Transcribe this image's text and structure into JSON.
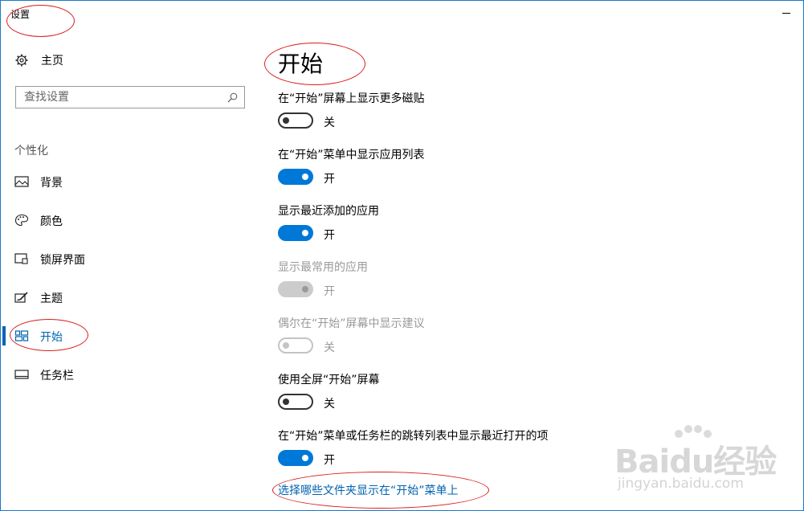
{
  "window": {
    "title": "设置"
  },
  "sidebar": {
    "home_label": "主页",
    "search_placeholder": "查找设置",
    "section_label": "个性化",
    "items": [
      {
        "label": "背景",
        "icon": "picture-icon",
        "active": false
      },
      {
        "label": "颜色",
        "icon": "palette-icon",
        "active": false
      },
      {
        "label": "锁屏界面",
        "icon": "lock-screen-icon",
        "active": false
      },
      {
        "label": "主题",
        "icon": "theme-icon",
        "active": false
      },
      {
        "label": "开始",
        "icon": "start-tiles-icon",
        "active": true
      },
      {
        "label": "任务栏",
        "icon": "taskbar-icon",
        "active": false
      }
    ]
  },
  "main": {
    "title": "开始",
    "settings": [
      {
        "label": "在“开始”屏幕上显示更多磁贴",
        "state": "关",
        "on": false,
        "enabled": true
      },
      {
        "label": "在“开始”菜单中显示应用列表",
        "state": "开",
        "on": true,
        "enabled": true
      },
      {
        "label": "显示最近添加的应用",
        "state": "开",
        "on": true,
        "enabled": true
      },
      {
        "label": "显示最常用的应用",
        "state": "开",
        "on": true,
        "enabled": false
      },
      {
        "label": "偶尔在“开始”屏幕中显示建议",
        "state": "关",
        "on": false,
        "enabled": false
      },
      {
        "label": "使用全屏“开始”屏幕",
        "state": "关",
        "on": false,
        "enabled": true
      },
      {
        "label": "在“开始”菜单或任务栏的跳转列表中显示最近打开的项",
        "state": "开",
        "on": true,
        "enabled": true
      }
    ],
    "folders_link": "选择哪些文件夹显示在“开始”菜单上"
  },
  "watermark": {
    "brand": "Baidu经验",
    "url": "jingyan.baidu.com"
  },
  "colors": {
    "accent": "#0078d7",
    "link": "#0063b1",
    "annotation": "#d81e1e"
  }
}
